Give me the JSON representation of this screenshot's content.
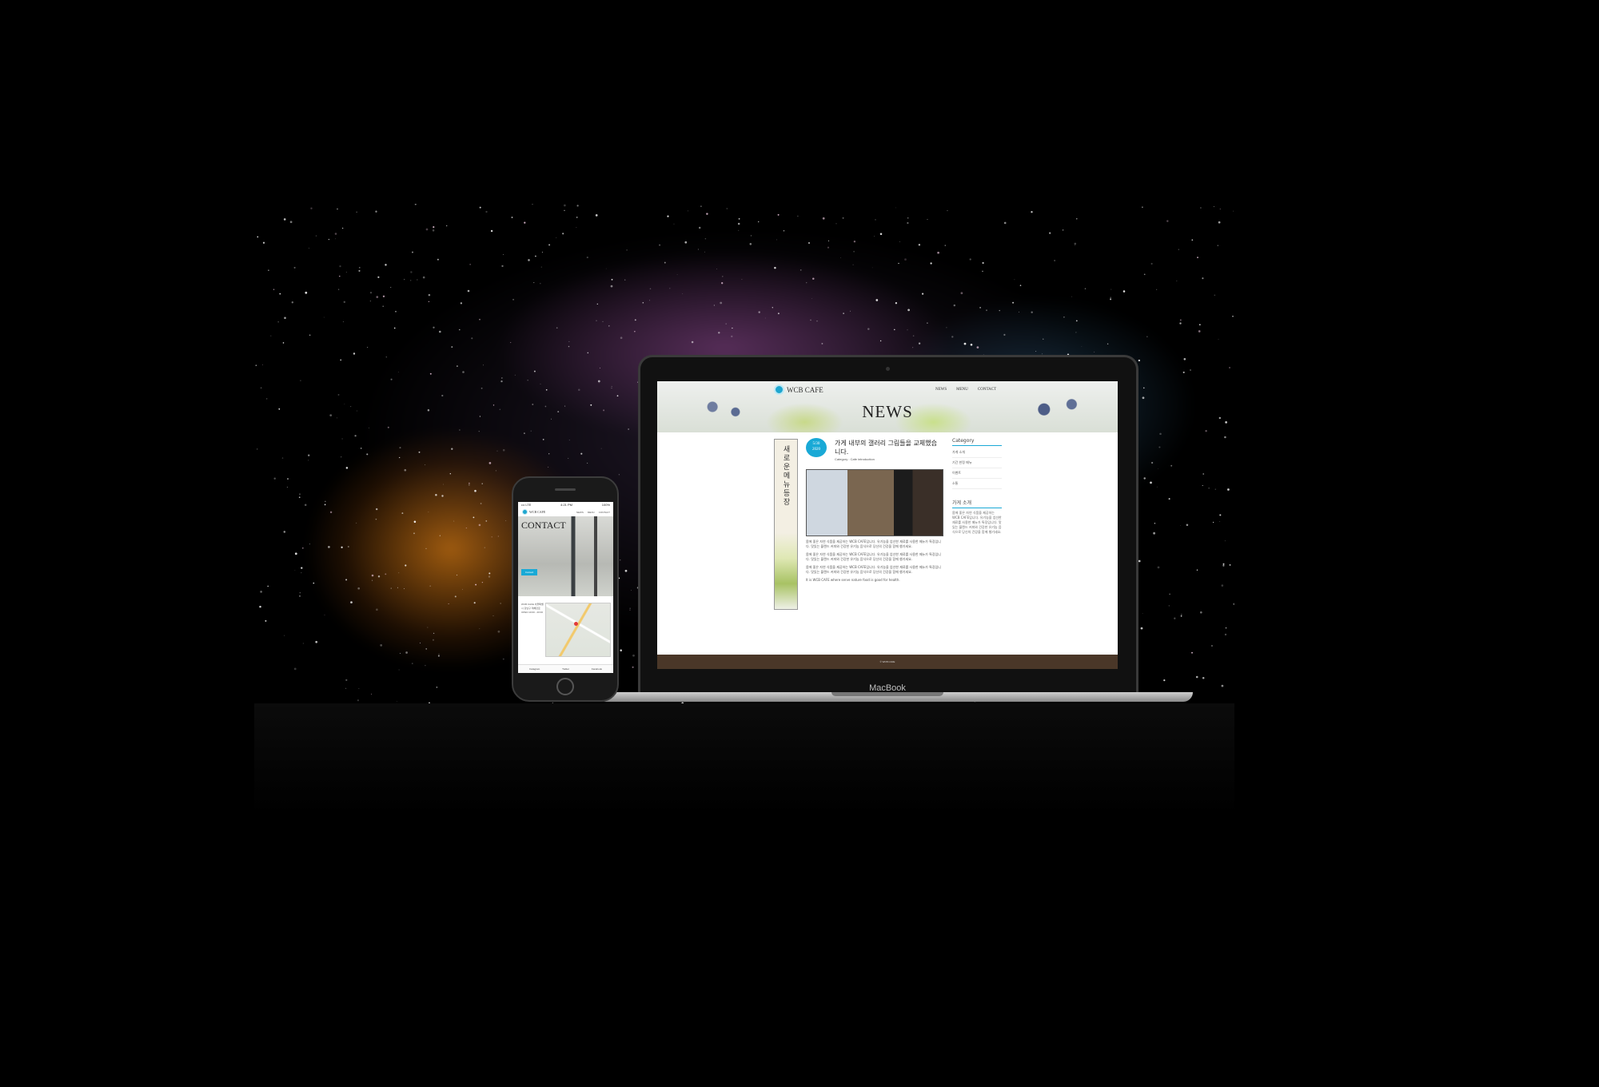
{
  "laptop": {
    "brand": "MacBook",
    "site": {
      "logo": "WCB CAFE",
      "nav": [
        "NEWS",
        "MENU",
        "CONTACT"
      ],
      "hero_title": "NEWS",
      "banner_text": "새로운 메뉴 등장",
      "post": {
        "date_main": "5/30",
        "date_year": "2020",
        "title": "가게 내부의 갤러리 그림들을 교체했습니다.",
        "meta": "Category : Cafe introduction",
        "paragraphs": [
          "몸에 좋은 자연 식품을 제공하는 WCB CAFE입니다. 유기농을 엄선한 재료를 사용한 메뉴가 특징입니다. 맛있는 블렌드 커피와 건강한 유기농 음식으로 당신의 건강을 함께 챙기세요.",
          "몸에 좋은 자연 식품을 제공하는 WCB CAFE입니다. 유기농을 엄선한 재료를 사용한 메뉴가 특징입니다. 맛있는 블렌드 커피와 건강한 유기농 음식으로 당신의 건강을 함께 챙기세요.",
          "몸에 좋은 자연 식품을 제공하는 WCB CAFE입니다. 유기농을 엄선한 재료를 사용한 메뉴가 특징입니다. 맛있는 블렌드 커피와 건강한 유기농 음식으로 당신의 건강을 함께 챙기세요.",
          "It is WCB CAFE where serve nature food is good for health."
        ]
      },
      "sidebar": {
        "category_title": "Category",
        "categories": [
          "가게 소개",
          "기간 한정 메뉴",
          "이벤트",
          "소통"
        ],
        "about_title": "가게 소개",
        "about_text": "몸에 좋은 자연 식품을 제공하는 WCB CAFE입니다. 유기농을 엄선한 재료를 사용한 메뉴가 특징입니다. 맛있는 블렌드 커피와 건강한 유기농 음식으로 당신의 건강을 함께 챙기세요."
      },
      "footer": "© WCB CAFE"
    }
  },
  "phone": {
    "status_left": "••• LTE",
    "status_time": "4:21 PM",
    "status_right": "100%",
    "logo": "WCB CAFE",
    "nav": [
      "NEWS",
      "MENU",
      "CONTACT"
    ],
    "title": "CONTACT",
    "button": "Contact",
    "address": "WCB CAFE 서울특별시 강남구 테헤란로 OPEN 10:00 - 20:00",
    "tabs": [
      "Instagram",
      "Twitter",
      "Facebook"
    ]
  },
  "colors": {
    "accent": "#19a9d6",
    "footer": "#4a3728"
  }
}
